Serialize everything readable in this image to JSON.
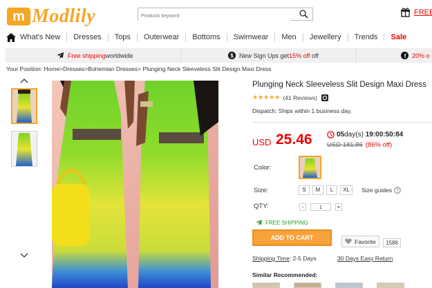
{
  "header": {
    "logo_text": "Modlily",
    "logo_mark": "m",
    "search_placeholder": "Products keyword",
    "free_label": "FREE"
  },
  "nav": {
    "items": [
      "What's New",
      "Dresses",
      "Tops",
      "Outerwear",
      "Bottoms",
      "Swimwear",
      "Men",
      "Jewellery",
      "Trends",
      "Sale"
    ]
  },
  "promo": {
    "free_shipping": "Free shipping",
    "worldwide": " worldwide",
    "signup_prefix": "New Sign Ups get ",
    "signup_discount": "15% off",
    "third_discount": "20% o"
  },
  "breadcrumb": {
    "prefix": "Your Position: ",
    "path": "Home>Dresses>Bohemian Dresses> ",
    "current": "Plunging Neck Sleeveless Slit Design Maxi Dress"
  },
  "product": {
    "title": "Plunging Neck Sleeveless Slit Design Maxi Dress",
    "stars": "★★★★★",
    "reviews": "(41 Reviews)",
    "dispatch": "Dispatch: Ships within 1 business day.",
    "currency": "USD",
    "price": "25.46",
    "timer_days": "05",
    "timer_days_label": "day(s)",
    "timer_time": "19:00:50:84",
    "old_price": "USD 181.86",
    "discount": "(86% off)",
    "color_label": "Color:",
    "size_label": "Size:",
    "sizes": [
      "S",
      "M",
      "L",
      "XL"
    ],
    "size_guide": "Size guides",
    "qty_label": "QTY:",
    "qty_minus": "-",
    "qty_value": "1",
    "qty_plus": "+",
    "free_shipping": "FREE SHIPPING",
    "add_to_cart": "ADD TO CART",
    "favorite": "Favorite",
    "favorite_count": "1586",
    "shipping_time_label": "Shipping Time",
    "shipping_time_value": ": 2-5 Days",
    "returns": "30 Days Easy Return",
    "similar": "Similar Recommended:"
  },
  "colors": {
    "accent": "#f5a623",
    "price_red": "#e00000",
    "dress_green": "#7ed321",
    "dress_yellow": "#e7e233",
    "dress_blue": "#1f5fd1"
  }
}
